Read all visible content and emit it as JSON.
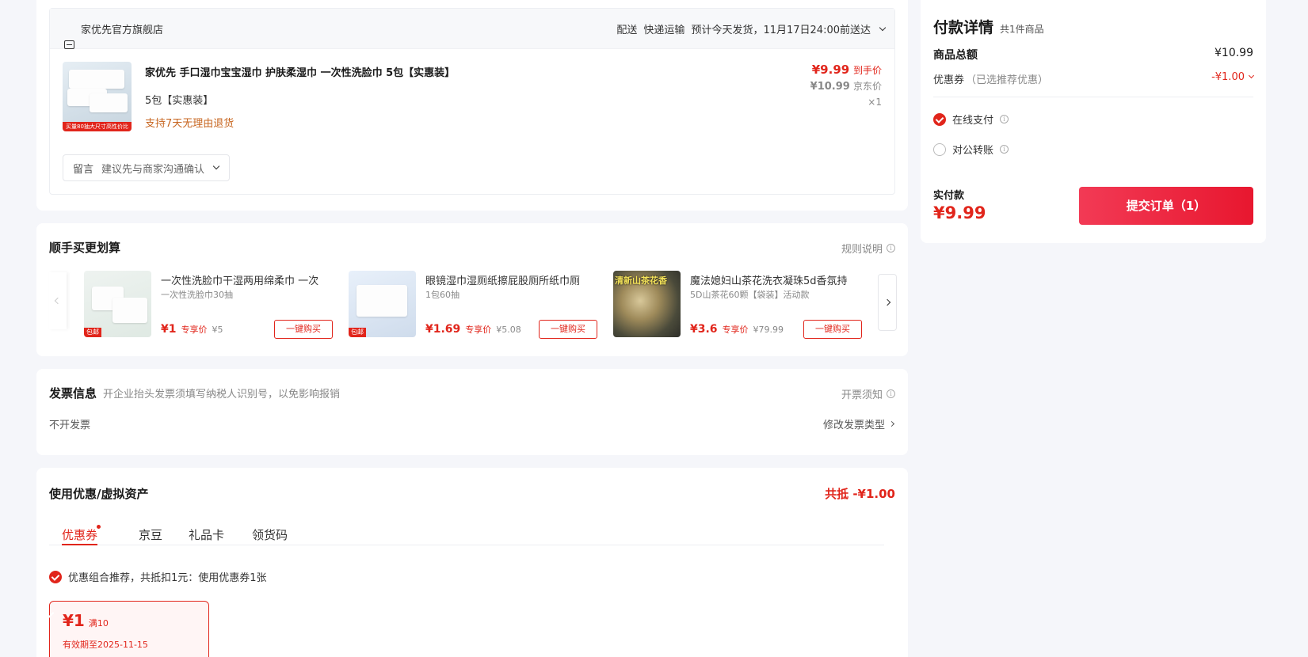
{
  "store": {
    "name": "家优先官方旗舰店",
    "delivery_label": "配送",
    "delivery_method": "快递运输",
    "delivery_estimate": "预计今天发货，11月17日24:00前送达"
  },
  "product": {
    "title": "家优先 手口湿巾宝宝湿巾 护肤柔湿巾 一次性洗脸巾 5包【实惠装】",
    "spec": "5包【实惠装】",
    "return_policy": "支持7天无理由退货",
    "price": "¥9.99",
    "price_label": "到手价",
    "orig_price": "¥10.99",
    "orig_price_label": "京东价",
    "quantity": "×1",
    "thumb_banner": "买量80抽大尺寸高性价比"
  },
  "message": {
    "label": "留言",
    "placeholder": "建议先与商家沟通确认"
  },
  "addon": {
    "title": "顺手买更划算",
    "rules_link": "规则说明",
    "items": [
      {
        "name": "一次性洗脸巾干湿两用绵柔巾 一次",
        "spec": "一次性洗脸巾30抽",
        "price": "¥1",
        "price_tag": "专享价",
        "orig": "¥5",
        "button": "一键购买",
        "badge": "包邮"
      },
      {
        "name": "眼镜湿巾湿厕纸擦屁股厕所纸巾厕",
        "spec": "1包60抽",
        "price": "¥1.69",
        "price_tag": "专享价",
        "orig": "¥5.08",
        "button": "一键购买",
        "badge": "包邮"
      },
      {
        "name": "魔法媳妇山茶花洗衣凝珠5d香氛持",
        "spec": "5D山茶花60颗【袋装】活动款",
        "price": "¥3.6",
        "price_tag": "专享价",
        "orig": "¥79.99",
        "button": "一键购买",
        "badge": "清新山茶花香"
      }
    ]
  },
  "invoice": {
    "title": "发票信息",
    "hint": "开企业抬头发票须填写纳税人识别号，以免影响报销",
    "notice_link": "开票须知",
    "current": "不开发票",
    "change_link": "修改发票类型"
  },
  "discount": {
    "title": "使用优惠/虚拟资产",
    "total": "共抵 -¥1.00",
    "tabs": [
      "优惠券",
      "京豆",
      "礼品卡",
      "领货码"
    ],
    "recommend": "优惠组合推荐，共抵扣1元：使用优惠券1张",
    "coupon": {
      "amount": "¥1",
      "condition": "满10",
      "expiry": "有效期至2025-11-15"
    }
  },
  "payment": {
    "title": "付款详情",
    "count": "共1件商品",
    "total_label": "商品总额",
    "total_value": "¥10.99",
    "coupon_label": "优惠券",
    "coupon_note": "（已选推荐优惠）",
    "coupon_value": "-¥1.00",
    "online_pay": "在线支付",
    "corporate_transfer": "对公转账",
    "actual_label": "实付款",
    "actual_value": "¥9.99",
    "submit": "提交订单（1）"
  }
}
